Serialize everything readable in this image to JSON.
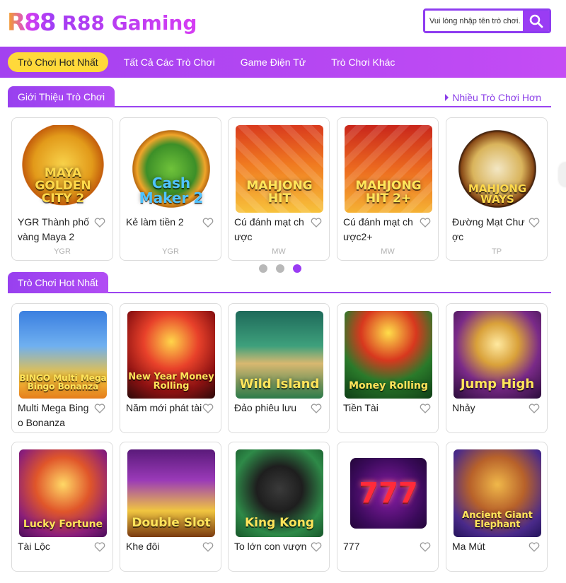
{
  "header": {
    "logo_mark": "R88",
    "logo_text": "R88 Gaming",
    "search_placeholder": "Vui lòng nhập tên trò chơi."
  },
  "nav": {
    "items": [
      {
        "label": "Trò Chơi Hot Nhất",
        "active": true
      },
      {
        "label": "Tất Cả Các Trò Chơi",
        "active": false
      },
      {
        "label": "Game Điện Tử",
        "active": false
      },
      {
        "label": "Trò Chơi Khác",
        "active": false
      }
    ]
  },
  "intro_section": {
    "title": "Giới Thiệu Trò Chơi",
    "more_link": "Nhiều Trò Chơi Hơn",
    "games": [
      {
        "name": "YGR Thành phố vàng Maya 2",
        "provider": "YGR",
        "art_text": "MAYA GOLDEN CITY 2"
      },
      {
        "name": "Kẻ làm tiền 2",
        "provider": "YGR",
        "art_text": "Cash Maker 2"
      },
      {
        "name": "Cú đánh mạt chược",
        "provider": "MW",
        "art_text": "MAHJONG HIT"
      },
      {
        "name": "Cú đánh mạt chược2+",
        "provider": "MW",
        "art_text": "MAHJONG HIT 2+"
      },
      {
        "name": "Đường Mạt Chược",
        "provider": "TP",
        "art_text": "MAHJONG WAYS"
      }
    ],
    "carousel": {
      "pages": 3,
      "active_page": 3
    }
  },
  "hot_section": {
    "title": "Trò Chơi Hot Nhất",
    "games": [
      {
        "name": "Multi Mega Bingo Bonanza",
        "art_text": "BINGO Multi Mega Bingo Bonanza"
      },
      {
        "name": "Năm mới phát tài",
        "art_text": "New Year Money Rolling"
      },
      {
        "name": "Đảo phiêu lưu",
        "art_text": "Wild Island"
      },
      {
        "name": "Tiền Tài",
        "art_text": "Money Rolling"
      },
      {
        "name": "Nhảy",
        "art_text": "Jump High"
      },
      {
        "name": "Tài Lộc",
        "art_text": "Lucky Fortune"
      },
      {
        "name": "Khe đôi",
        "art_text": "Double Slot"
      },
      {
        "name": "To lớn con vượn",
        "art_text": "King Kong"
      },
      {
        "name": "777",
        "art_text": "777"
      },
      {
        "name": "Ma Mút",
        "art_text": "Ancient Giant Elephant"
      }
    ]
  },
  "colors": {
    "brand_purple": "#9a3cf3",
    "nav_active_yellow": "#ffd93a",
    "provider_gray": "#b0b0b0"
  }
}
